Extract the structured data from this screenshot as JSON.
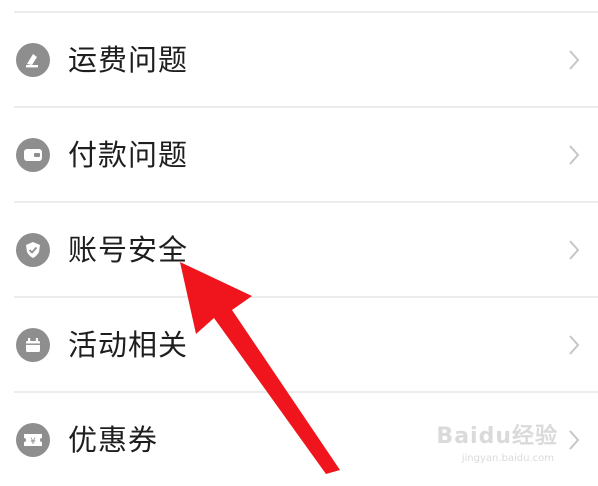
{
  "menu": {
    "items": [
      {
        "label": "运费问题",
        "icon": "shipping-fee-icon"
      },
      {
        "label": "付款问题",
        "icon": "wallet-icon"
      },
      {
        "label": "账号安全",
        "icon": "shield-icon"
      },
      {
        "label": "活动相关",
        "icon": "calendar-gift-icon"
      },
      {
        "label": "优惠券",
        "icon": "coupon-icon"
      }
    ]
  },
  "watermark": {
    "brand": "Baidu经验",
    "url": "jingyan.baidu.com"
  },
  "colors": {
    "icon_gray": "#8e8e8e",
    "divider": "#ececec",
    "annotation_arrow": "#f0151c"
  }
}
